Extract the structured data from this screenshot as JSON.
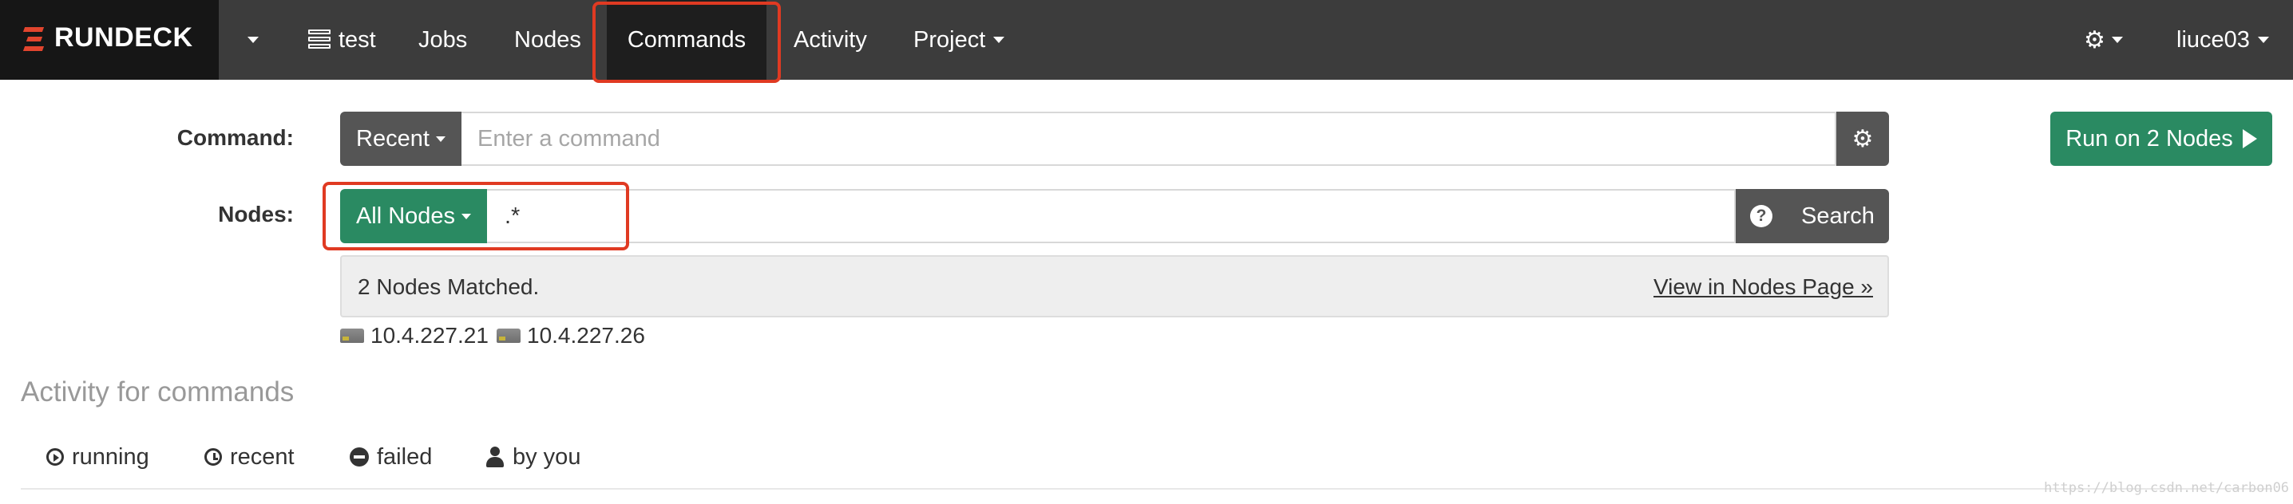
{
  "app": {
    "brand": "RUNDECK"
  },
  "nav": {
    "project_icon": "server-icon",
    "project_label": "test",
    "items": [
      {
        "label": "Jobs"
      },
      {
        "label": "Nodes"
      },
      {
        "label": "Commands"
      },
      {
        "label": "Activity"
      },
      {
        "label": "Project"
      }
    ],
    "active": "Commands",
    "settings_icon": "gear-icon",
    "user": "liuce03"
  },
  "command": {
    "label": "Command:",
    "recent_label": "Recent",
    "placeholder": "Enter a command",
    "value": "",
    "options_icon": "gear-icon",
    "run_label": "Run on 2 Nodes"
  },
  "nodes": {
    "label": "Nodes:",
    "filter_label": "All Nodes",
    "filter_value": ".*",
    "help_icon": "question-circle-icon",
    "search_label": "Search"
  },
  "matched": {
    "text": "2 Nodes Matched.",
    "link": "View in Nodes Page »",
    "list": [
      "10.4.227.21",
      "10.4.227.26"
    ]
  },
  "activity": {
    "title": "Activity for commands",
    "tabs": [
      {
        "label": "running",
        "icon": "play-circle-icon"
      },
      {
        "label": "recent",
        "icon": "clock-icon"
      },
      {
        "label": "failed",
        "icon": "minus-circle-icon"
      },
      {
        "label": "by you",
        "icon": "user-icon"
      }
    ]
  },
  "colors": {
    "navbar": "#3c3c3c",
    "brand_bg": "#161616",
    "accent_green": "#2a8a62",
    "button_gray": "#555555",
    "highlight_red": "#e03a22"
  },
  "watermark": "https://blog.csdn.net/carbon06"
}
